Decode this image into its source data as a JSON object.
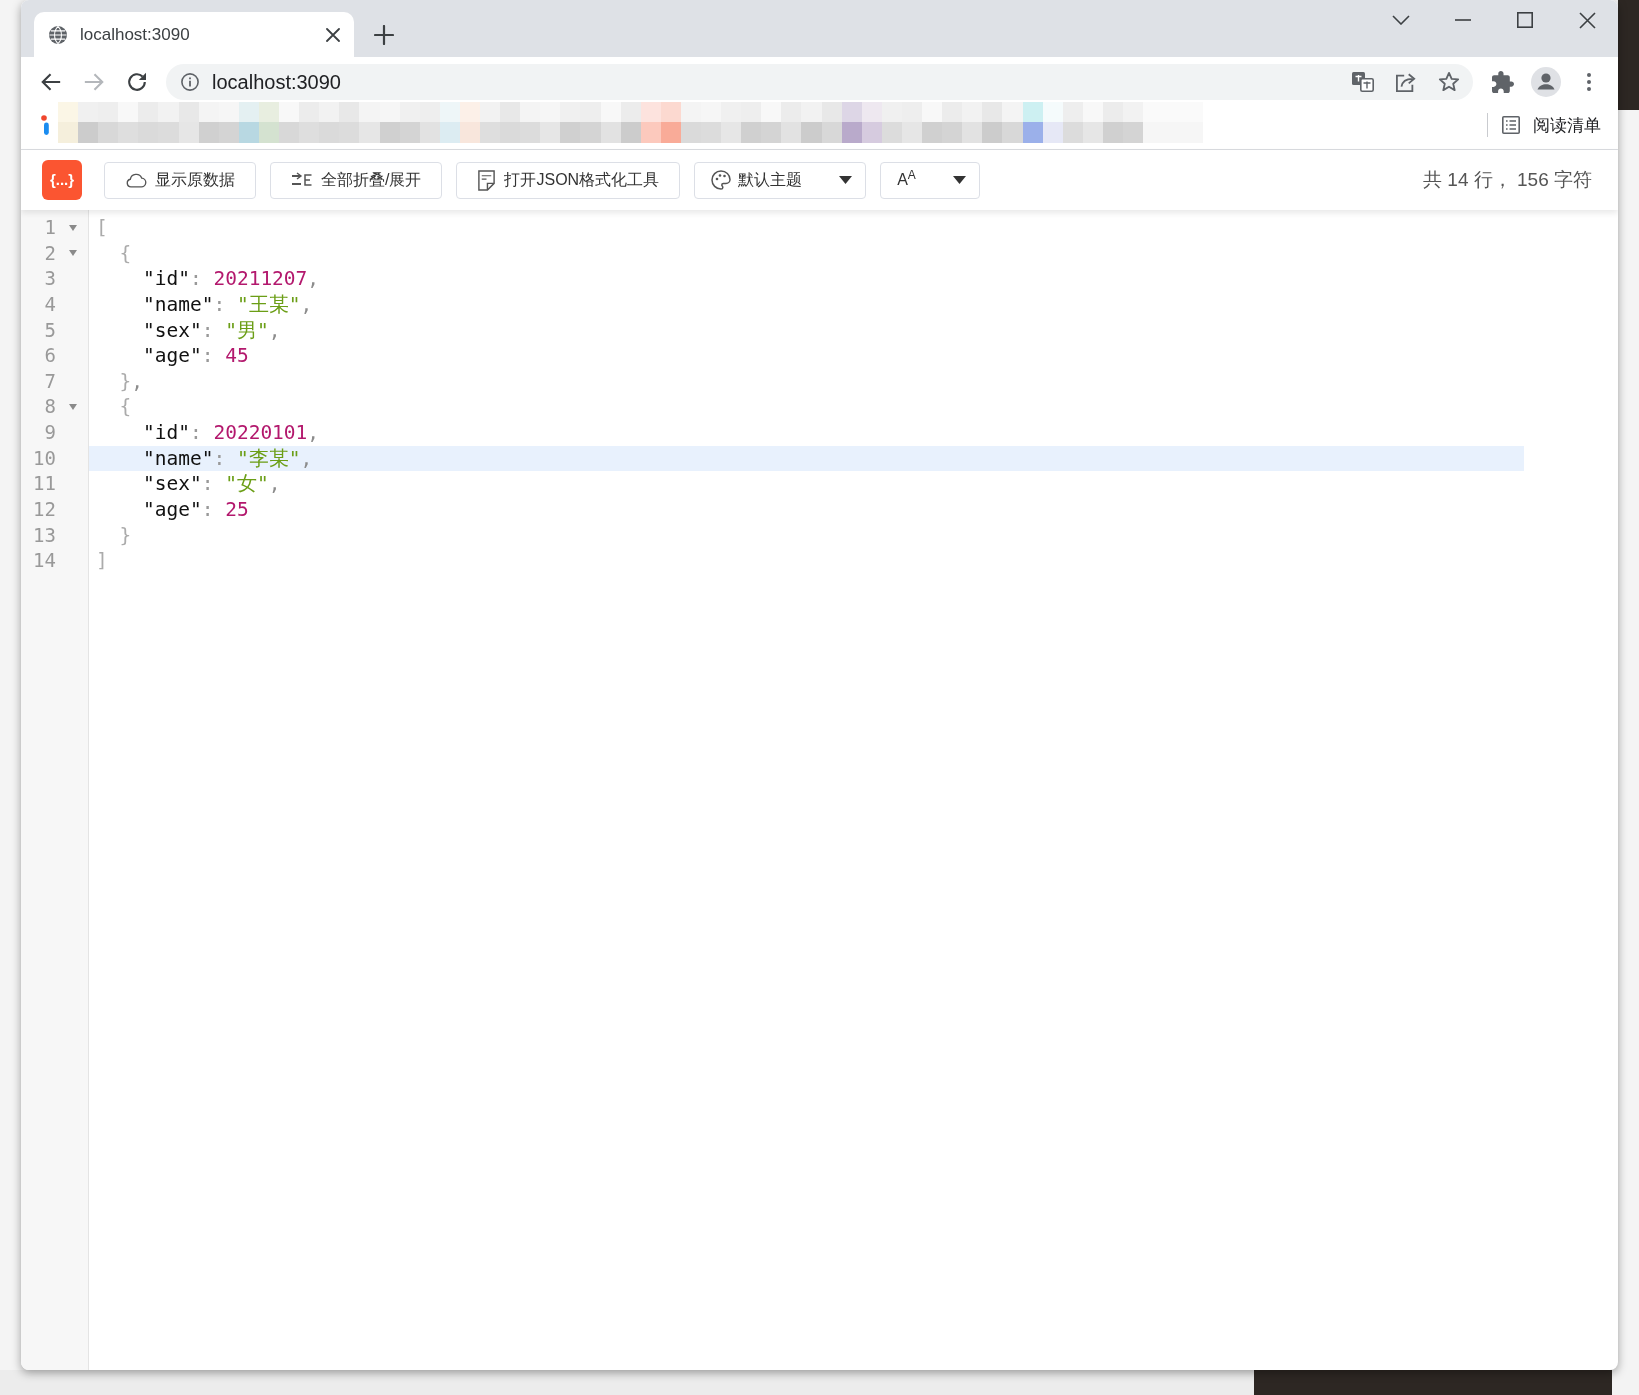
{
  "browser": {
    "tabs": [
      {
        "title": "localhost:3090",
        "selected": true
      }
    ],
    "navigation": [
      {
        "kind": "back",
        "disabled": false
      },
      {
        "kind": "forward",
        "disabled": true
      },
      {
        "kind": "reload",
        "disabled": false
      }
    ],
    "address": "localhost:3090",
    "reading_list": "阅读清单"
  },
  "viewer": {
    "logo": "{...}",
    "buttons": [
      {
        "kind": "button",
        "label": "显示原数据"
      },
      {
        "kind": "button",
        "label": "全部折叠/展开"
      },
      {
        "kind": "button",
        "label": "打开JSON格式化工具"
      },
      {
        "kind": "dropdown",
        "label": "默认主题"
      },
      {
        "kind": "dropdown",
        "label": "A$^{A}$"
      }
    ],
    "stats": "共 14 行， 156 字符",
    "lines": [
      {
        "number": "1",
        "foldable": true,
        "selected": false,
        "tokens": [
          {
            "kind": "bracket",
            "text": "["
          }
        ],
        "children": [
          {
            "number": "2",
            "foldable": true,
            "selected": false,
            "tokens": [
              {
                "kind": "bracket",
                "text": "{"
              }
            ],
            "children": [
              {
                "number": "3",
                "foldable": false,
                "selected": false,
                "tokens": [
                  {
                    "kind": "key",
                    "text": "\"id\""
                  },
                  {
                    "kind": "colon",
                    "text": ":"
                  },
                  {
                    "kind": "number",
                    "text": "20211207"
                  },
                  {
                    "kind": "comma",
                    "text": ","
                  }
                ]
              },
              {
                "number": "4",
                "foldable": false,
                "selected": false,
                "tokens": [
                  {
                    "kind": "key",
                    "text": "\"name\""
                  },
                  {
                    "kind": "colon",
                    "text": ":"
                  },
                  {
                    "kind": "string",
                    "text": "\"王某\""
                  },
                  {
                    "kind": "comma",
                    "text": ","
                  }
                ]
              },
              {
                "number": "5",
                "foldable": false,
                "selected": false,
                "tokens": [
                  {
                    "kind": "key",
                    "text": "\"sex\""
                  },
                  {
                    "kind": "colon",
                    "text": ":"
                  },
                  {
                    "kind": "string",
                    "text": "\"男\""
                  },
                  {
                    "kind": "comma",
                    "text": ","
                  }
                ]
              },
              {
                "number": "6",
                "foldable": false,
                "selected": false,
                "tokens": [
                  {
                    "kind": "key",
                    "text": "\"age\""
                  },
                  {
                    "kind": "colon",
                    "text": ":"
                  },
                  {
                    "kind": "number",
                    "text": "45"
                  }
                ]
              }
            ]
          },
          {
            "number": "7",
            "foldable": false,
            "selected": false,
            "tokens": [
              {
                "kind": "bracket",
                "text": "}"
              },
              {
                "kind": "comma",
                "text": ","
              }
            ]
          },
          {
            "number": "8",
            "foldable": true,
            "selected": false,
            "tokens": [
              {
                "kind": "bracket",
                "text": "{"
              }
            ],
            "children": [
              {
                "number": "9",
                "foldable": false,
                "selected": false,
                "tokens": [
                  {
                    "kind": "key",
                    "text": "\"id\""
                  },
                  {
                    "kind": "colon",
                    "text": ":"
                  },
                  {
                    "kind": "number",
                    "text": "20220101"
                  },
                  {
                    "kind": "comma",
                    "text": ","
                  }
                ]
              },
              {
                "number": "10",
                "foldable": false,
                "selected": true,
                "tokens": [
                  {
                    "kind": "key",
                    "text": "\"name\""
                  },
                  {
                    "kind": "colon",
                    "text": ":"
                  },
                  {
                    "kind": "string",
                    "text": "\"李某\""
                  },
                  {
                    "kind": "comma",
                    "text": ","
                  }
                ]
              },
              {
                "number": "11",
                "foldable": false,
                "selected": false,
                "tokens": [
                  {
                    "kind": "key",
                    "text": "\"sex\""
                  },
                  {
                    "kind": "colon",
                    "text": ":"
                  },
                  {
                    "kind": "string",
                    "text": "\"女\""
                  },
                  {
                    "kind": "comma",
                    "text": ","
                  }
                ]
              },
              {
                "number": "12",
                "foldable": false,
                "selected": false,
                "tokens": [
                  {
                    "kind": "key",
                    "text": "\"age\""
                  },
                  {
                    "kind": "colon",
                    "text": ":"
                  },
                  {
                    "kind": "number",
                    "text": "25"
                  }
                ]
              }
            ]
          },
          {
            "number": "13",
            "foldable": false,
            "selected": false,
            "tokens": [
              {
                "kind": "bracket",
                "text": "}"
              }
            ]
          }
        ]
      },
      {
        "number": "14",
        "foldable": false,
        "selected": false,
        "tokens": [
          {
            "kind": "bracket",
            "text": "]"
          }
        ]
      }
    ]
  }
}
